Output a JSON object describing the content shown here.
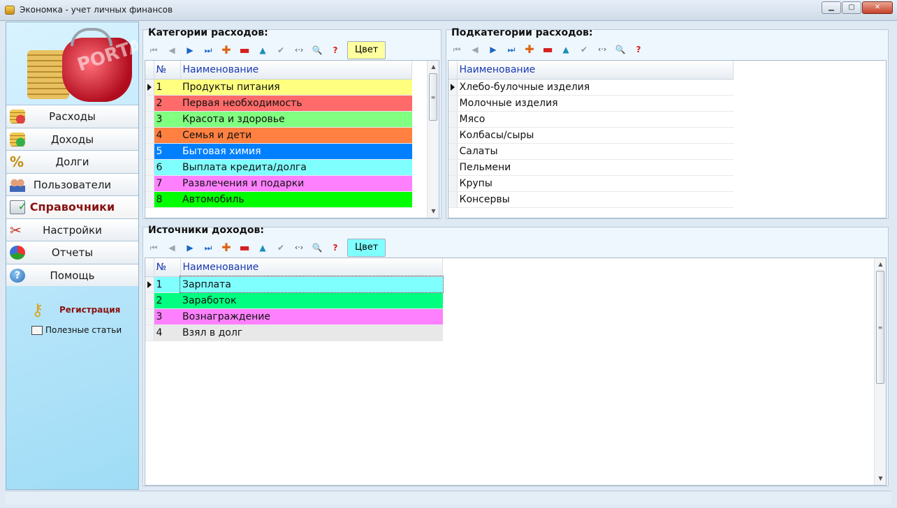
{
  "window": {
    "title": "Экономка - учет личных финансов",
    "minimize": "▁",
    "maximize": "▢",
    "close": "✕"
  },
  "sidebar": {
    "watermark": "PORTAL",
    "items": [
      {
        "label": "Расходы",
        "icon": "expenses-icon"
      },
      {
        "label": "Доходы",
        "icon": "income-icon"
      },
      {
        "label": "Долги",
        "icon": "percent-icon"
      },
      {
        "label": "Пользователи",
        "icon": "users-icon"
      },
      {
        "label": "Справочники",
        "icon": "reference-icon",
        "active": true
      },
      {
        "label": "Настройки",
        "icon": "settings-icon"
      },
      {
        "label": "Отчеты",
        "icon": "reports-icon"
      },
      {
        "label": "Помощь",
        "icon": "help-icon"
      }
    ],
    "registration": "Регистрация",
    "articles": "Полезные статьи"
  },
  "toolbar_glyphs": {
    "first": "⏮",
    "prev": "◀",
    "next": "▶",
    "last": "⏭",
    "add": "✚",
    "delete": "▬",
    "up": "▲",
    "apply": "✔",
    "swap": "‹·›",
    "search": "🔍",
    "help": "?"
  },
  "expense_categories": {
    "title": "Категории расходов:",
    "color_button": "Цвет",
    "color_button_bg": "#ffffa0",
    "columns": [
      "№",
      "Наименование"
    ],
    "rows": [
      {
        "num": "1",
        "name": "Продукты питания",
        "color": "#ffff80"
      },
      {
        "num": "2",
        "name": "Первая необходимость",
        "color": "#ff6a6a"
      },
      {
        "num": "3",
        "name": "Красота и здоровье",
        "color": "#80ff80"
      },
      {
        "num": "4",
        "name": "Семья и дети",
        "color": "#ff8040"
      },
      {
        "num": "5",
        "name": "Бытовая химия",
        "color": "#0080ff"
      },
      {
        "num": "6",
        "name": "Выплата кредита/долга",
        "color": "#80ffff"
      },
      {
        "num": "7",
        "name": "Развлечения и подарки",
        "color": "#ff80ff"
      },
      {
        "num": "8",
        "name": "Автомобиль",
        "color": "#00ff00"
      }
    ]
  },
  "expense_subcategories": {
    "title": "Подкатегории расходов:",
    "columns": [
      "Наименование"
    ],
    "rows": [
      "Хлебо-булочные изделия",
      "Молочные изделия",
      "Мясо",
      "Колбасы/сыры",
      "Салаты",
      "Пельмени",
      "Крупы",
      "Консервы"
    ]
  },
  "income_sources": {
    "title": "Источники доходов:",
    "color_button": "Цвет",
    "color_button_bg": "#80ffff",
    "columns": [
      "№",
      "Наименование"
    ],
    "rows": [
      {
        "num": "1",
        "name": "Зарплата",
        "color": "#80ffff"
      },
      {
        "num": "2",
        "name": "Заработок",
        "color": "#00ff80"
      },
      {
        "num": "3",
        "name": "Вознаграждение",
        "color": "#ff80ff"
      },
      {
        "num": "4",
        "name": "Взял в долг",
        "color": "#e8e8e8"
      }
    ]
  }
}
